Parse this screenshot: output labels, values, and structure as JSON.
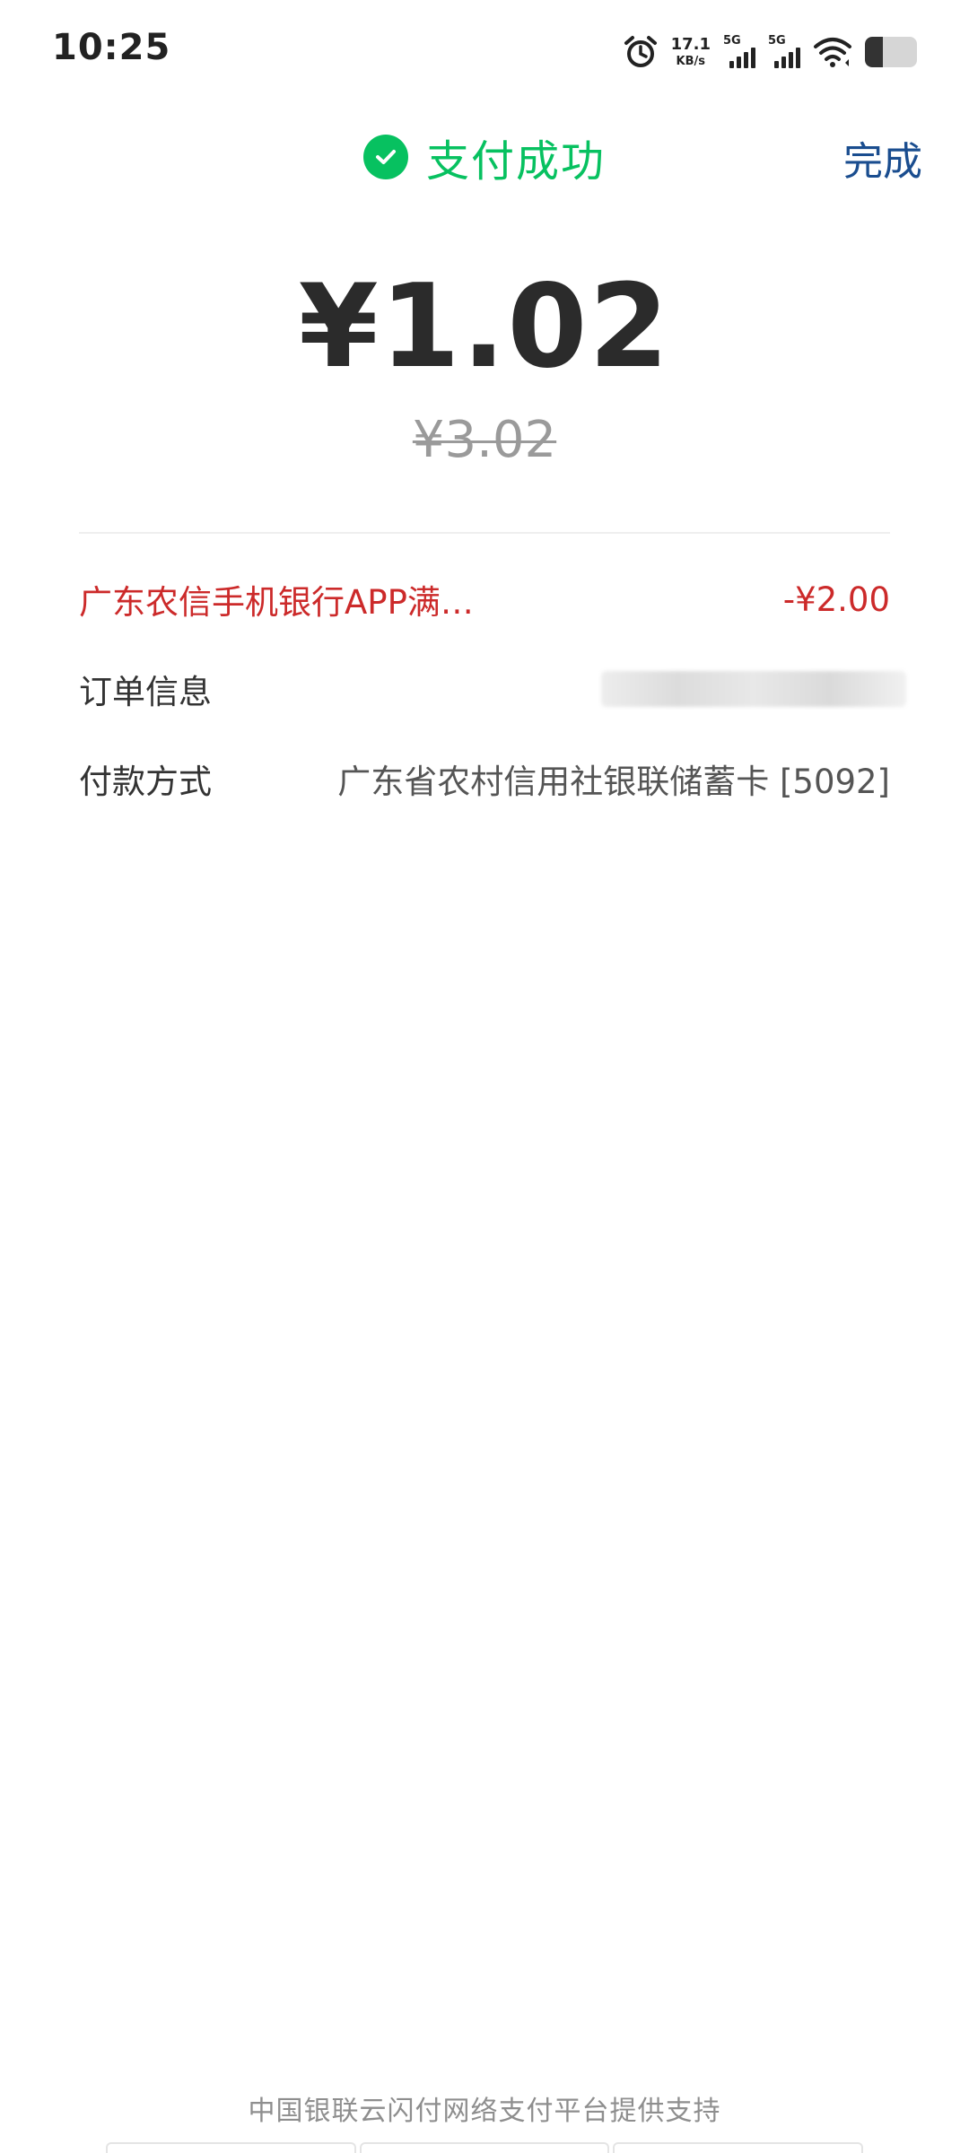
{
  "status_bar": {
    "time": "10:25",
    "net_speed_value": "17.1",
    "net_speed_unit": "KB/s",
    "signal1_label": "5G",
    "signal2_label": "5G",
    "icons": [
      "alarm-icon",
      "wifi-icon",
      "battery-icon"
    ]
  },
  "header": {
    "title": "支付成功",
    "done_label": "完成",
    "success_color": "#07c160",
    "link_color": "#1a4d8f"
  },
  "amount": {
    "paid": "¥1.02",
    "original": "¥3.02"
  },
  "details": {
    "discount": {
      "label": "广东农信手机银行APP满…",
      "value": "-¥2.00",
      "color": "#cc2a2a"
    },
    "order": {
      "label": "订单信息"
    },
    "payment": {
      "label": "付款方式",
      "value": "广东省农村信用社银联储蓄卡 [5092]"
    }
  },
  "footer": {
    "text": "中国银联云闪付网络支付平台提供支持"
  }
}
